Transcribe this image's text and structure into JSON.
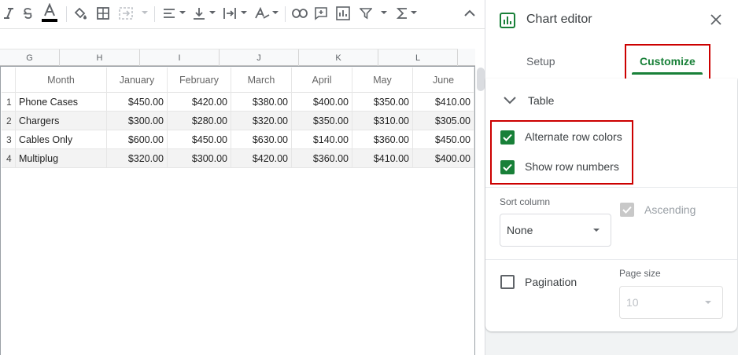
{
  "sheet": {
    "columns": [
      "G",
      "H",
      "I",
      "J",
      "K",
      "L"
    ]
  },
  "table": {
    "headers": [
      "Month",
      "January",
      "February",
      "March",
      "April",
      "May",
      "June"
    ],
    "rows": [
      {
        "num": "1",
        "cells": [
          "Phone Cases",
          "$450.00",
          "$420.00",
          "$380.00",
          "$400.00",
          "$350.00",
          "$410.00"
        ]
      },
      {
        "num": "2",
        "cells": [
          "Chargers",
          "$300.00",
          "$280.00",
          "$320.00",
          "$350.00",
          "$310.00",
          "$305.00"
        ]
      },
      {
        "num": "3",
        "cells": [
          "Cables Only",
          "$600.00",
          "$450.00",
          "$630.00",
          "$140.00",
          "$360.00",
          "$450.00"
        ]
      },
      {
        "num": "4",
        "cells": [
          "Multiplug",
          "$320.00",
          "$300.00",
          "$420.00",
          "$360.00",
          "$410.00",
          "$400.00"
        ]
      }
    ]
  },
  "editor": {
    "title": "Chart editor",
    "tabs": {
      "setup": "Setup",
      "customize": "Customize"
    },
    "section": "Table",
    "options": {
      "alternate_row_colors": {
        "label": "Alternate row colors",
        "checked": true
      },
      "show_row_numbers": {
        "label": "Show row numbers",
        "checked": true
      }
    },
    "sort": {
      "label": "Sort column",
      "value": "None",
      "ascending_label": "Ascending"
    },
    "pagination": {
      "label": "Pagination",
      "page_size_label": "Page size",
      "page_size_value": "10"
    }
  },
  "colors": {
    "accent_green": "#188038",
    "highlight_red": "#cc0000",
    "alt_row": "#f3f3f3"
  }
}
